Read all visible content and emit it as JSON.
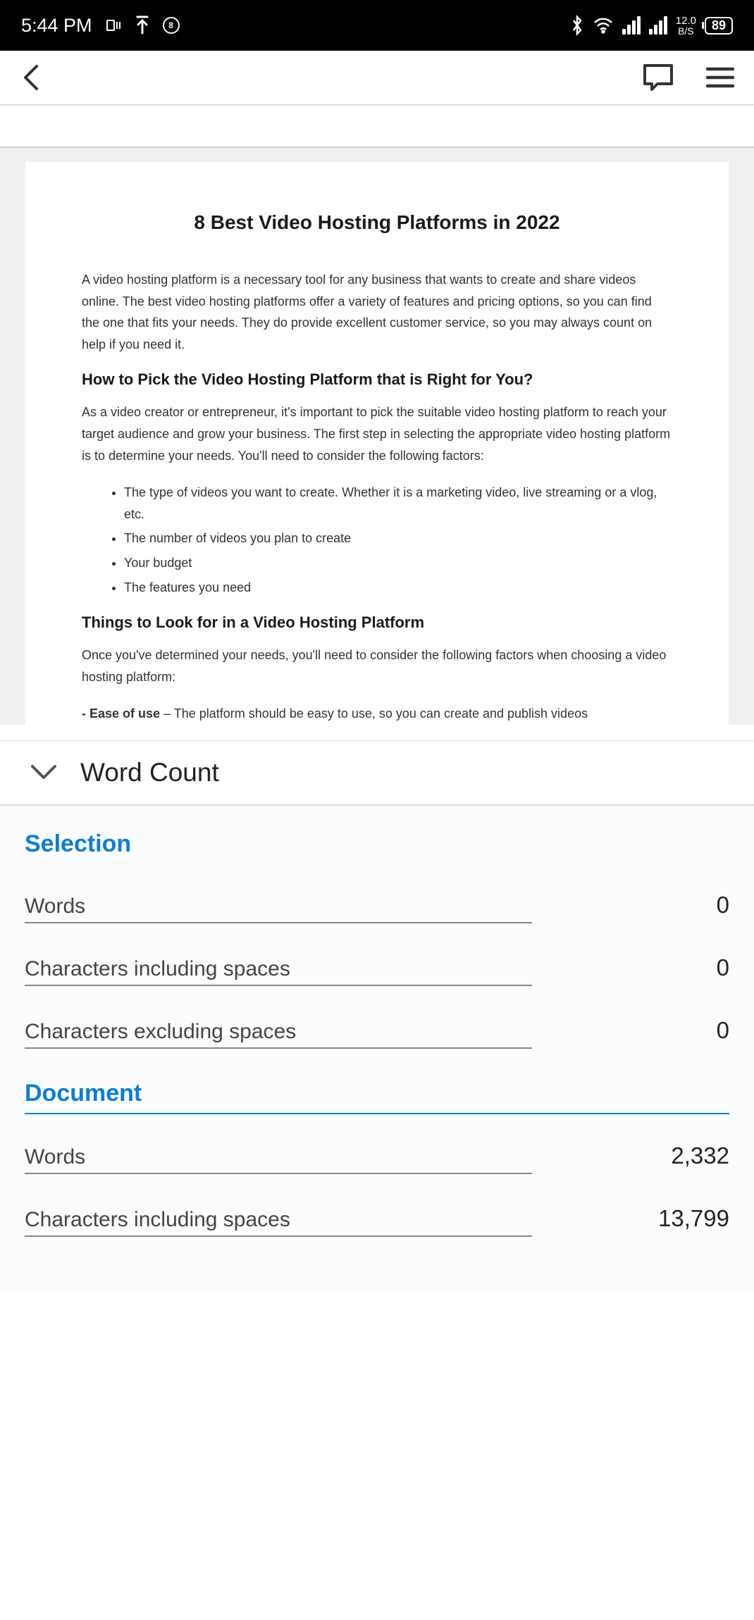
{
  "status": {
    "time": "5:44 PM",
    "speed_value": "12.0",
    "speed_unit": "B/S",
    "battery": "89",
    "badge_num": "8"
  },
  "document": {
    "title": "8 Best Video Hosting Platforms in 2022",
    "intro": "A video hosting platform is a necessary tool for any business that wants to create and share videos online. The best video hosting platforms offer a variety of features and pricing options, so you can find the one that fits your needs. They do provide excellent customer service, so you may always count on help if you need it.",
    "section1_heading": "How to Pick the Video Hosting Platform that is Right for You?",
    "section1_para": "As a video creator or entrepreneur, it's important to pick the suitable video hosting platform to reach your target audience and grow your business. The first step in selecting the appropriate video hosting platform is to determine your needs. You'll need to consider the following factors:",
    "bullets": [
      "The type of videos you want to create. Whether it is a marketing video, live streaming or a vlog, etc.",
      "The number of videos you plan to create",
      "Your budget",
      "The features you need"
    ],
    "section2_heading": "Things to Look for in a Video Hosting Platform",
    "section2_para": "Once you've determined your needs, you'll need to consider the following factors when choosing a video hosting platform:",
    "ease_label": "- Ease of use",
    "ease_text": " – The platform should be easy to use, so you can create and publish videos"
  },
  "panel": {
    "title": "Word Count",
    "selection_heading": "Selection",
    "document_heading": "Document",
    "rows": {
      "words_label": "Words",
      "chars_incl_label": "Characters including spaces",
      "chars_excl_label": "Characters excluding spaces",
      "sel_words": "0",
      "sel_chars_incl": "0",
      "sel_chars_excl": "0",
      "doc_words": "2,332",
      "doc_chars_incl": "13,799"
    }
  }
}
